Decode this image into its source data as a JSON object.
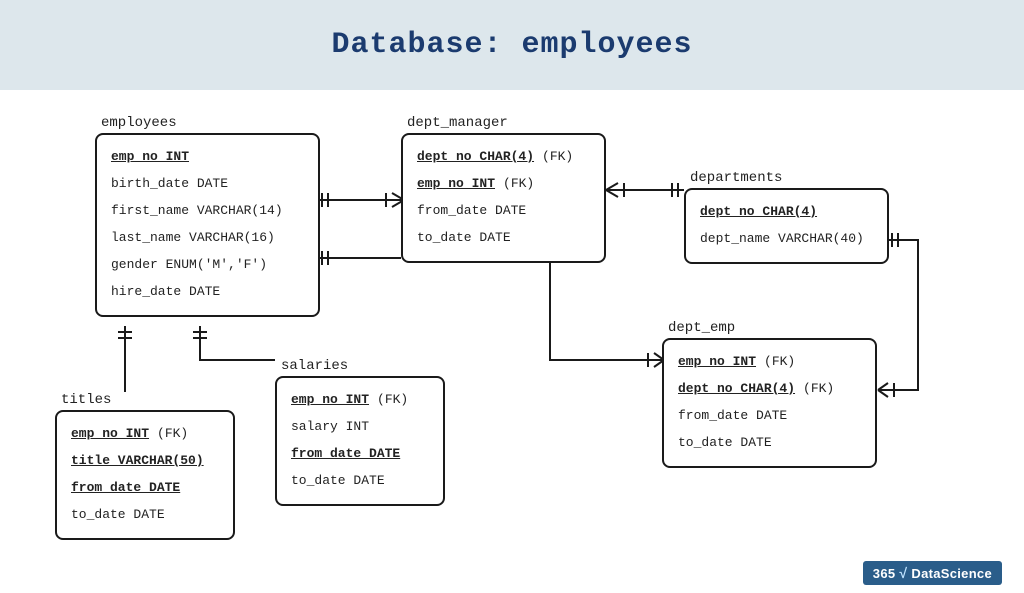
{
  "page_title": "Database: employees",
  "entities": {
    "employees": {
      "title": "employees",
      "fields": [
        {
          "name": "emp_no",
          "type": "INT",
          "pk": true
        },
        {
          "name": "birth_date",
          "type": "DATE"
        },
        {
          "name": "first_name",
          "type": "VARCHAR(14)"
        },
        {
          "name": "last_name",
          "type": "VARCHAR(16)"
        },
        {
          "name": "gender",
          "type": "ENUM('M','F')"
        },
        {
          "name": "hire_date",
          "type": "DATE"
        }
      ]
    },
    "dept_manager": {
      "title": "dept_manager",
      "fields": [
        {
          "name": "dept_no",
          "type": "CHAR(4)",
          "pk": true,
          "fk": true
        },
        {
          "name": "emp_no",
          "type": "INT",
          "pk": true,
          "fk": true
        },
        {
          "name": "from_date",
          "type": "DATE"
        },
        {
          "name": "to_date",
          "type": "DATE"
        }
      ]
    },
    "departments": {
      "title": "departments",
      "fields": [
        {
          "name": "dept_no",
          "type": "CHAR(4)",
          "pk": true
        },
        {
          "name": "dept_name",
          "type": "VARCHAR(40)"
        }
      ]
    },
    "titles": {
      "title": "titles",
      "fields": [
        {
          "name": "emp_no",
          "type": "INT",
          "pk": true,
          "fk": true
        },
        {
          "name": "title",
          "type": "VARCHAR(50)",
          "pk": true
        },
        {
          "name": "from_date",
          "type": "DATE",
          "pk": true
        },
        {
          "name": "to_date",
          "type": "DATE"
        }
      ]
    },
    "salaries": {
      "title": "salaries",
      "fields": [
        {
          "name": "emp_no",
          "type": "INT",
          "pk": true,
          "fk": true
        },
        {
          "name": "salary",
          "type": "INT"
        },
        {
          "name": "from_date",
          "type": "DATE",
          "pk": true
        },
        {
          "name": "to_date",
          "type": "DATE"
        }
      ]
    },
    "dept_emp": {
      "title": "dept_emp",
      "fields": [
        {
          "name": "emp_no",
          "type": "INT",
          "pk": true,
          "fk": true
        },
        {
          "name": "dept_no",
          "type": "CHAR(4)",
          "pk": true,
          "fk": true
        },
        {
          "name": "from_date",
          "type": "DATE"
        },
        {
          "name": "to_date",
          "type": "DATE"
        }
      ]
    }
  },
  "relationships": [
    {
      "from": "employees",
      "to": "dept_manager",
      "via": "emp_no"
    },
    {
      "from": "departments",
      "to": "dept_manager",
      "via": "dept_no"
    },
    {
      "from": "employees",
      "to": "dept_emp",
      "via": "emp_no"
    },
    {
      "from": "departments",
      "to": "dept_emp",
      "via": "dept_no"
    },
    {
      "from": "employees",
      "to": "titles",
      "via": "emp_no"
    },
    {
      "from": "employees",
      "to": "salaries",
      "via": "emp_no"
    }
  ],
  "brand": {
    "prefix": "365",
    "suffix": "DataScience"
  }
}
